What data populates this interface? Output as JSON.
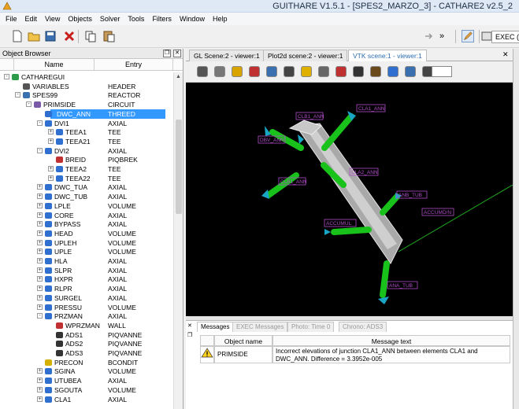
{
  "window": {
    "title": "GUITHARE V1.5.1 - [SPES2_MARZO_3] - CATHARE2 v2.5_2"
  },
  "menu": [
    "File",
    "Edit",
    "View",
    "Objects",
    "Solver",
    "Tools",
    "Filters",
    "Window",
    "Help"
  ],
  "toolbar": {
    "left_icons": [
      "new-file-icon",
      "open-folder-icon",
      "save-icon",
      "delete-icon",
      "copy-icon",
      "paste-icon"
    ],
    "right_icons": [
      "arrow-icon",
      "chevron-double-right-icon",
      "edit-icon"
    ],
    "chevron_text": "»",
    "exec_field": "EXEC (FC"
  },
  "object_browser": {
    "title": "Object Browser",
    "columns": {
      "name": "Name",
      "entry": "Entry"
    },
    "rows": [
      {
        "name": "CATHAREGUI",
        "entry": "",
        "level": 0,
        "exp": "-",
        "icon": "#2c9c4a"
      },
      {
        "name": "VARIABLES",
        "entry": "HEADER",
        "level": 1,
        "exp": "",
        "icon": "#555555"
      },
      {
        "name": "SPES99",
        "entry": "REACTOR",
        "level": 1,
        "exp": "-",
        "icon": "#3a6fb0"
      },
      {
        "name": "PRIMSIDE",
        "entry": "CIRCUIT",
        "level": 2,
        "exp": "-",
        "icon": "#7a5aa8"
      },
      {
        "name": "DWC_ANN",
        "entry": "THREED",
        "level": 3,
        "exp": "",
        "icon": "#2f6fd0",
        "selected": true
      },
      {
        "name": "DVI1",
        "entry": "AXIAL",
        "level": 3,
        "exp": "-",
        "icon": "#2f6fd0"
      },
      {
        "name": "TEEA1",
        "entry": "TEE",
        "level": 4,
        "exp": "+",
        "icon": "#2f6fd0"
      },
      {
        "name": "TEEA21",
        "entry": "TEE",
        "level": 4,
        "exp": "+",
        "icon": "#2f6fd0"
      },
      {
        "name": "DVI2",
        "entry": "AXIAL",
        "level": 3,
        "exp": "-",
        "icon": "#2f6fd0"
      },
      {
        "name": "BREID",
        "entry": "PIQBREK",
        "level": 4,
        "exp": "",
        "icon": "#c03030"
      },
      {
        "name": "TEEA2",
        "entry": "TEE",
        "level": 4,
        "exp": "+",
        "icon": "#2f6fd0"
      },
      {
        "name": "TEEA22",
        "entry": "TEE",
        "level": 4,
        "exp": "+",
        "icon": "#2f6fd0"
      },
      {
        "name": "DWC_TUA",
        "entry": "AXIAL",
        "level": 3,
        "exp": "+",
        "icon": "#2f6fd0"
      },
      {
        "name": "DWC_TUB",
        "entry": "AXIAL",
        "level": 3,
        "exp": "+",
        "icon": "#2f6fd0"
      },
      {
        "name": "LPLE",
        "entry": "VOLUME",
        "level": 3,
        "exp": "+",
        "icon": "#2f6fd0"
      },
      {
        "name": "CORE",
        "entry": "AXIAL",
        "level": 3,
        "exp": "+",
        "icon": "#2f6fd0"
      },
      {
        "name": "BYPASS",
        "entry": "AXIAL",
        "level": 3,
        "exp": "+",
        "icon": "#2f6fd0"
      },
      {
        "name": "HEAD",
        "entry": "VOLUME",
        "level": 3,
        "exp": "+",
        "icon": "#2f6fd0"
      },
      {
        "name": "UPLEH",
        "entry": "VOLUME",
        "level": 3,
        "exp": "+",
        "icon": "#2f6fd0"
      },
      {
        "name": "UPLE",
        "entry": "VOLUME",
        "level": 3,
        "exp": "+",
        "icon": "#2f6fd0"
      },
      {
        "name": "HLA",
        "entry": "AXIAL",
        "level": 3,
        "exp": "+",
        "icon": "#2f6fd0"
      },
      {
        "name": "SLPR",
        "entry": "AXIAL",
        "level": 3,
        "exp": "+",
        "icon": "#2f6fd0"
      },
      {
        "name": "HXPR",
        "entry": "AXIAL",
        "level": 3,
        "exp": "+",
        "icon": "#2f6fd0"
      },
      {
        "name": "RLPR",
        "entry": "AXIAL",
        "level": 3,
        "exp": "+",
        "icon": "#2f6fd0"
      },
      {
        "name": "SURGEL",
        "entry": "AXIAL",
        "level": 3,
        "exp": "+",
        "icon": "#2f6fd0"
      },
      {
        "name": "PRESSU",
        "entry": "VOLUME",
        "level": 3,
        "exp": "+",
        "icon": "#2f6fd0"
      },
      {
        "name": "PRZMAN",
        "entry": "AXIAL",
        "level": 3,
        "exp": "-",
        "icon": "#2f6fd0"
      },
      {
        "name": "WPRZMAN",
        "entry": "WALL",
        "level": 4,
        "exp": "",
        "icon": "#c03030"
      },
      {
        "name": "ADS1",
        "entry": "PIQVANNE",
        "level": 4,
        "exp": "",
        "icon": "#333333"
      },
      {
        "name": "ADS2",
        "entry": "PIQVANNE",
        "level": 4,
        "exp": "",
        "icon": "#333333"
      },
      {
        "name": "ADS3",
        "entry": "PIQVANNE",
        "level": 4,
        "exp": "",
        "icon": "#333333"
      },
      {
        "name": "PRECON",
        "entry": "BCONDIT",
        "level": 3,
        "exp": "",
        "icon": "#d4b000"
      },
      {
        "name": "SGINA",
        "entry": "VOLUME",
        "level": 3,
        "exp": "+",
        "icon": "#2f6fd0"
      },
      {
        "name": "UTUBEA",
        "entry": "AXIAL",
        "level": 3,
        "exp": "+",
        "icon": "#2f6fd0"
      },
      {
        "name": "SGOUTA",
        "entry": "VOLUME",
        "level": 3,
        "exp": "+",
        "icon": "#2f6fd0"
      },
      {
        "name": "CLA1",
        "entry": "AXIAL",
        "level": 3,
        "exp": "+",
        "icon": "#2f6fd0"
      }
    ]
  },
  "scene_tabs": [
    "GL Scene:2 - viewer:1",
    "Plot2d scene:2 - viewer:1",
    "VTK scene:1 - viewer:1"
  ],
  "vtk_toolbar_icons": [
    "dump-view-icon",
    "pan-icon",
    "zoom-icon",
    "rotate-icon",
    "global-pan-icon",
    "fit-all-icon",
    "fit-area-icon",
    "front-view-icon",
    "back-view-icon",
    "top-view-icon",
    "camera-icon",
    "reset-icon",
    "scaling-icon",
    "graduated-axes-icon"
  ],
  "scene_labels": [
    "CLA1_ANN",
    "CLB1_ANN",
    "DBV_ANN",
    "CLA2_ANN",
    "CLB1_ANN",
    "ANB_TUB",
    "ACCUMD/N",
    "ACCUMUL",
    "ANA_TUB"
  ],
  "messages": {
    "tabs": [
      "Messages",
      "EXEC Messages",
      "Photo: Time 0",
      "Chrono: ADS3"
    ],
    "columns": {
      "object": "Object name",
      "text": "Message text"
    },
    "rows": [
      {
        "object": "PRIMSIDE",
        "text_line1": "Incorrect elevations of junction CLA1_ANN between elements CLA1 and",
        "text_line2": "DWC_ANN. Difference = 3.3952e-005"
      }
    ]
  },
  "colors": {
    "selection": "#3399ff",
    "cylinders": "#18c21a",
    "arrows": "#19a6c4",
    "label": "#b04cc8",
    "vessel": "#c9c9c9"
  }
}
